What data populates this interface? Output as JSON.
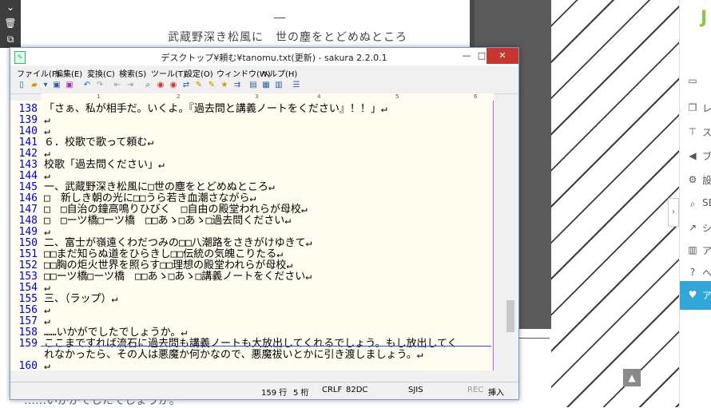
{
  "background_page": {
    "dash": "—",
    "poem_line": "武蔵野深き松風に　世の塵をとどめぬところ",
    "bottom_line": "……いかがでしたでしょうか。",
    "left_toolbar_icons": [
      "chevron-down-icon",
      "trash-icon",
      "copy-icon"
    ],
    "logo_letter": "J",
    "nav_items": [
      {
        "icon": "monitor-icon",
        "label": ""
      },
      {
        "icon": "copy-icon",
        "label": "レ"
      },
      {
        "icon": "pin-icon",
        "label": "ス"
      },
      {
        "icon": "megaphone-icon",
        "label": "ブ"
      },
      {
        "icon": "gear-icon",
        "label": "設"
      },
      {
        "icon": "search-icon",
        "label": "SE"
      },
      {
        "icon": "share-icon",
        "label": "シ"
      },
      {
        "icon": "chart-icon",
        "label": "ア"
      },
      {
        "icon": "help-icon",
        "label": "ヘ"
      },
      {
        "icon": "heart-icon",
        "label": "ア"
      }
    ]
  },
  "window": {
    "title": "デスクトップ¥頼む¥tanomu.txt(更新) - sakura 2.2.0.1",
    "minimize": "—",
    "maximize": "□",
    "close": "✕",
    "menu": [
      "ファイル(F)",
      "編集(E)",
      "変換(C)",
      "検索(S)",
      "ツール(T)",
      "設定(O)",
      "ウィンドウ(W)",
      "ヘルプ(H)"
    ],
    "ruler_marks": [
      "1",
      "2",
      "3",
      "4",
      "5",
      "6"
    ],
    "lines": [
      {
        "no": "138",
        "text": "「さぁ、私が相手だ。いくよ。『過去問と講義ノートをください』！！」↵"
      },
      {
        "no": "139",
        "text": "↵"
      },
      {
        "no": "140",
        "text": "↵"
      },
      {
        "no": "141",
        "text": "６．校歌で歌って頼む↵"
      },
      {
        "no": "142",
        "text": "↵"
      },
      {
        "no": "143",
        "text": "校歌「過去問ください」↵"
      },
      {
        "no": "144",
        "text": "↵"
      },
      {
        "no": "145",
        "text": "一、武蔵野深き松風に□世の塵をとどめぬところ↵"
      },
      {
        "no": "146",
        "text": "□　新しき朝の光に□□うら若き血潮さながら↵"
      },
      {
        "no": "147",
        "text": "□　□自治の鐘高鳴りひびく　□自由の殿堂われらが母校↵"
      },
      {
        "no": "148",
        "text": "□　□ーツ橋□ーツ橋　□□あゝ□あゝ□過去問ください↵"
      },
      {
        "no": "149",
        "text": "↵"
      },
      {
        "no": "150",
        "text": "二、富士が嶺遠くわだつみの□□八潮路をさきがけゆきて↵"
      },
      {
        "no": "151",
        "text": "□□まだ知らぬ道をひらきし□□伝統の気魄こりたる↵"
      },
      {
        "no": "152",
        "text": "□□胸の炬火世界を照らす□□理想の殿堂われらが母校↵"
      },
      {
        "no": "153",
        "text": "□□ーツ橋□ーツ橋　□□あゝ□あゝ□講義ノートをください↵"
      },
      {
        "no": "154",
        "text": "↵"
      },
      {
        "no": "155",
        "text": "三、（ラップ）↵"
      },
      {
        "no": "156",
        "text": "↵"
      },
      {
        "no": "157",
        "text": "↵"
      },
      {
        "no": "158",
        "text": "……いかがでしたでしょうか。↵"
      },
      {
        "no": "159",
        "text": "ここまですれば流石に過去問も講義ノートも大放出してくれるでしょう。もし放出してく"
      },
      {
        "no": "",
        "text": "れなかったら、その人は悪魔か何かなので、悪魔祓いとかに引き渡しましょう。↵"
      },
      {
        "no": "160",
        "text": "↵"
      }
    ],
    "status": {
      "line": "159 行",
      "col": "5 桁",
      "eol": "CRLF",
      "code": "82DC",
      "encoding": "SJIS",
      "rec": "REC",
      "mode": "挿入"
    }
  }
}
